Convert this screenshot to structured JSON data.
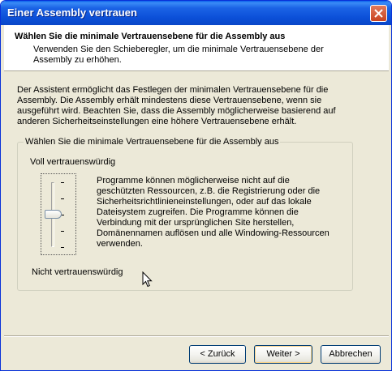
{
  "window": {
    "title": "Einer Assembly vertrauen"
  },
  "header": {
    "title": "Wählen Sie die minimale Vertrauensebene für die Assembly aus",
    "subtitle": "Verwenden Sie den Schieberegler, um die minimale Vertrauensebene der Assembly zu erhöhen."
  },
  "description": "Der Assistent ermöglicht das Festlegen der minimalen Vertrauensebene für die Assembly. Die Assembly erhält mindestens diese Vertrauensebene, wenn sie ausgeführt wird. Beachten Sie, dass die Assembly möglicherweise basierend auf anderen Sicherheitseinstellungen eine höhere Vertrauensebene erhält.",
  "group": {
    "label": "Wählen Sie die minimale Vertrauensebene für die Assembly aus",
    "high_label": "Voll vertrauenswürdig",
    "low_label": "Nicht vertrauenswürdig",
    "slider": {
      "levels": 5,
      "selected_level": 2
    },
    "level_description": "Programme können möglicherweise nicht auf die geschützten Ressourcen, z.B. die Registrierung oder die Sicherheitsrichtlinieneinstellungen, oder auf das lokale Dateisystem zugreifen. Die Programme können die Verbindung mit der ursprünglichen Site herstellen, Domänennamen auflösen und alle Windowing-Ressourcen verwenden."
  },
  "buttons": {
    "back": "< Zurück",
    "next": "Weiter >",
    "cancel": "Abbrechen"
  },
  "icons": {
    "close": "close-icon",
    "cursor": "mouse-pointer-icon"
  }
}
